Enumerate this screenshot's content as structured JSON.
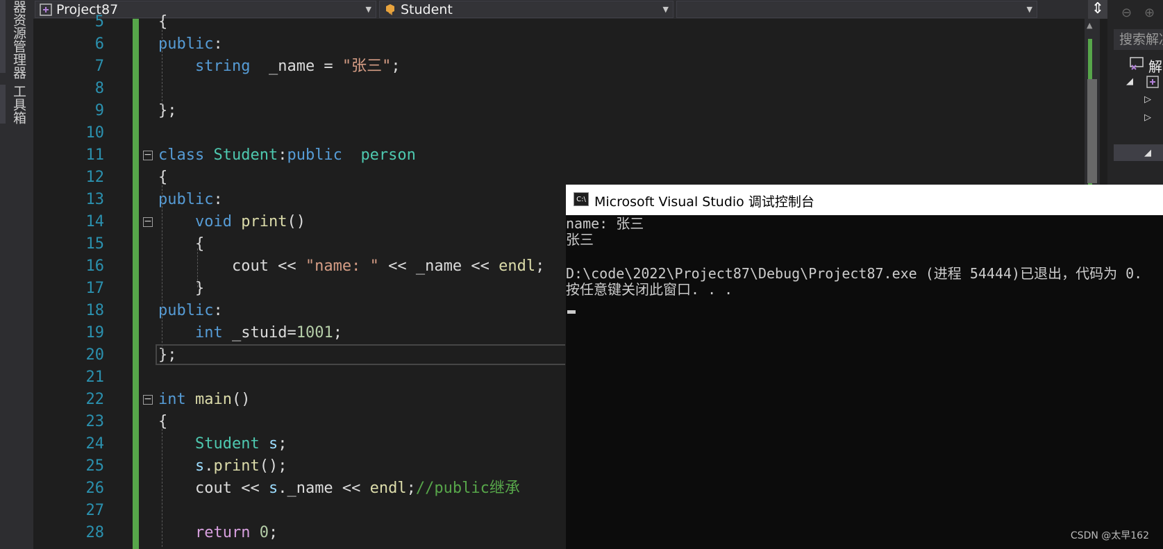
{
  "left_tabs": [
    "器资源管理器",
    "工具箱"
  ],
  "navbar": {
    "project_combo": "Project87",
    "class_combo": "Student",
    "member_combo": ""
  },
  "editor": {
    "line_numbers": [
      "5",
      "6",
      "7",
      "8",
      "9",
      "10",
      "11",
      "12",
      "13",
      "14",
      "15",
      "16",
      "17",
      "18",
      "19",
      "20",
      "21",
      "22",
      "23",
      "24",
      "25",
      "26",
      "27",
      "28"
    ],
    "lines": [
      {
        "text": "{"
      },
      {
        "parts": [
          {
            "t": "public",
            "c": "kw"
          },
          {
            "t": ":",
            "c": ""
          }
        ]
      },
      {
        "parts": [
          {
            "t": "    ",
            "c": ""
          },
          {
            "t": "string",
            "c": "kw"
          },
          {
            "t": "  _name = ",
            "c": ""
          },
          {
            "t": "\"张三\"",
            "c": "str"
          },
          {
            "t": ";",
            "c": ""
          }
        ]
      },
      {
        "text": ""
      },
      {
        "text": "};"
      },
      {
        "text": ""
      },
      {
        "parts": [
          {
            "t": "class ",
            "c": "kw"
          },
          {
            "t": "Student",
            "c": "ty"
          },
          {
            "t": ":",
            "c": ""
          },
          {
            "t": "public",
            "c": "kw"
          },
          {
            "t": "  ",
            "c": ""
          },
          {
            "t": "person",
            "c": "ty"
          }
        ]
      },
      {
        "text": "{"
      },
      {
        "parts": [
          {
            "t": "public",
            "c": "kw"
          },
          {
            "t": ":",
            "c": ""
          }
        ]
      },
      {
        "parts": [
          {
            "t": "    ",
            "c": ""
          },
          {
            "t": "void ",
            "c": "kw"
          },
          {
            "t": "print",
            "c": "fn"
          },
          {
            "t": "()",
            "c": ""
          }
        ]
      },
      {
        "text": "    {"
      },
      {
        "parts": [
          {
            "t": "        cout << ",
            "c": ""
          },
          {
            "t": "\"name: \"",
            "c": "str"
          },
          {
            "t": " << _name << ",
            "c": ""
          },
          {
            "t": "endl",
            "c": "fn"
          },
          {
            "t": ";",
            "c": ""
          }
        ]
      },
      {
        "text": "    }"
      },
      {
        "parts": [
          {
            "t": "public",
            "c": "kw"
          },
          {
            "t": ":",
            "c": ""
          }
        ]
      },
      {
        "parts": [
          {
            "t": "    ",
            "c": ""
          },
          {
            "t": "int ",
            "c": "kw"
          },
          {
            "t": "_stuid",
            "c": ""
          },
          {
            "t": "=",
            "c": ""
          },
          {
            "t": "1001",
            "c": "num"
          },
          {
            "t": ";",
            "c": ""
          }
        ]
      },
      {
        "text": "};"
      },
      {
        "text": ""
      },
      {
        "parts": [
          {
            "t": "int ",
            "c": "kw"
          },
          {
            "t": "main",
            "c": "fn"
          },
          {
            "t": "()",
            "c": ""
          }
        ]
      },
      {
        "text": "{"
      },
      {
        "parts": [
          {
            "t": "    ",
            "c": ""
          },
          {
            "t": "Student ",
            "c": "ty"
          },
          {
            "t": "s",
            "c": "var"
          },
          {
            "t": ";",
            "c": ""
          }
        ]
      },
      {
        "parts": [
          {
            "t": "    ",
            "c": ""
          },
          {
            "t": "s",
            "c": "var"
          },
          {
            "t": ".",
            "c": ""
          },
          {
            "t": "print",
            "c": "fn"
          },
          {
            "t": "();",
            "c": ""
          }
        ]
      },
      {
        "parts": [
          {
            "t": "    cout << ",
            "c": ""
          },
          {
            "t": "s",
            "c": "var"
          },
          {
            "t": ".",
            "c": ""
          },
          {
            "t": "_name",
            "c": ""
          },
          {
            "t": " << ",
            "c": ""
          },
          {
            "t": "endl",
            "c": "fn"
          },
          {
            "t": ";",
            "c": ""
          },
          {
            "t": "//public继承",
            "c": "cm"
          }
        ]
      },
      {
        "text": ""
      },
      {
        "parts": [
          {
            "t": "    ",
            "c": ""
          },
          {
            "t": "return ",
            "c": "ret"
          },
          {
            "t": "0",
            "c": "num"
          },
          {
            "t": ";",
            "c": ""
          }
        ]
      }
    ]
  },
  "solution_explorer": {
    "search_placeholder": "搜索解决",
    "root_label": "解"
  },
  "console": {
    "title": "Microsoft Visual Studio 调试控制台",
    "icon_label": "C:\\",
    "lines": [
      "name: 张三",
      "张三",
      "",
      "D:\\code\\2022\\Project87\\Debug\\Project87.exe (进程 54444)已退出，代码为 0.",
      "按任意键关闭此窗口. . ."
    ]
  },
  "watermark": "CSDN @太早162"
}
